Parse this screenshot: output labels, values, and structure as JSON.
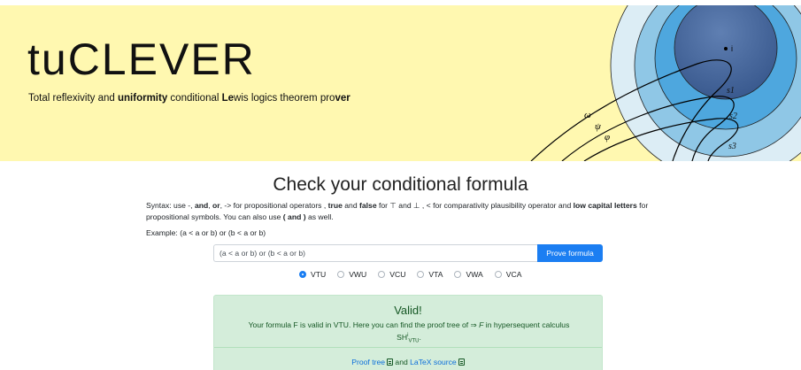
{
  "header": {
    "logo": "tuCLEVER",
    "tagline_parts": [
      "Total reflexivity and ",
      "uniformity",
      " conditional ",
      "Le",
      "wis logics theorem pro",
      "ver"
    ],
    "illustration_labels": {
      "i": "i",
      "s1": "s1",
      "s2": "s2",
      "s3": "s3",
      "omega": "ω",
      "psi": "ψ",
      "phi": "φ"
    }
  },
  "main": {
    "title": "Check your conditional formula",
    "syntax": {
      "p1": "Syntax: use -, ",
      "and": "and",
      "p2": ", ",
      "or": "or",
      "p3": ", -> for propositional operators , ",
      "true": "true",
      "p4": " and ",
      "false": "false",
      "p5": " for ⊤ and ⊥ , < for comparativity plausibility operator and ",
      "low": "low capital letters",
      "p6": " for propositional symbols. You can also use ",
      "parens": "( and )",
      "p7": " as well."
    },
    "example": "Example: (a < a or b) or (b < a or b)",
    "formula_input_value": "(a < a or b) or (b < a or b)",
    "prove_button": "Prove formula",
    "logics": [
      {
        "label": "VTU",
        "selected": true
      },
      {
        "label": "VWU",
        "selected": false
      },
      {
        "label": "VCU",
        "selected": false
      },
      {
        "label": "VTA",
        "selected": false
      },
      {
        "label": "VWA",
        "selected": false
      },
      {
        "label": "VCA",
        "selected": false
      }
    ]
  },
  "result": {
    "title": "Valid!",
    "text_a": "Your formula F is valid in VTU. Here you can find the proof tree of ⇒ ",
    "text_f": "F",
    "text_b": " in hypersequent calculus",
    "calculus": "SH",
    "calculus_sup": "i",
    "calculus_sub": "VTU",
    "proof_tree_link": "Proof tree",
    "and_text": "and",
    "latex_link": "LaTeX source"
  },
  "colors": {
    "banner": "#fff8b0",
    "primary": "#1b7ef2",
    "success_bg": "#d4edda",
    "success_text": "#155724"
  }
}
